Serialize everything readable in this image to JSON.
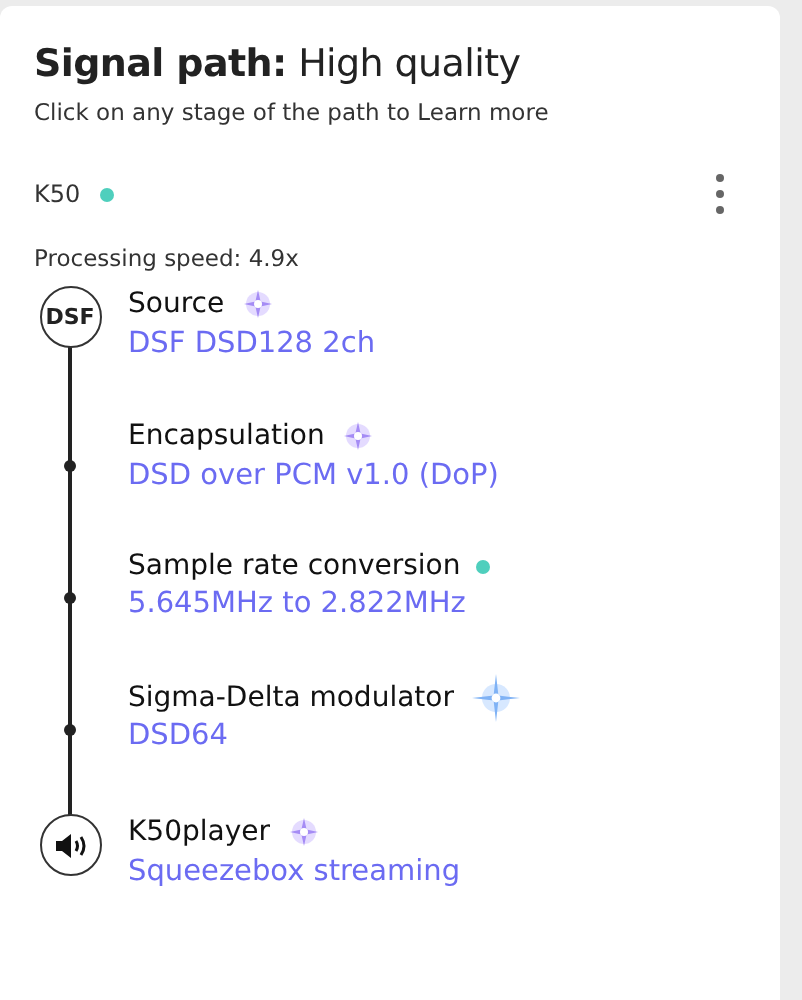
{
  "header": {
    "title": "Signal path:",
    "quality": "High quality",
    "subtitle": "Click on any stage of the path to Learn more"
  },
  "device": {
    "name": "K50",
    "color": "#4fcfbd"
  },
  "processing_speed": "Processing speed: 4.9x",
  "stages": [
    {
      "node": {
        "kind": "source",
        "label": "DSF"
      },
      "title": "Source",
      "value": "DSF DSD128 2ch",
      "indicator": {
        "kind": "sparkle"
      }
    },
    {
      "node": {
        "kind": "step"
      },
      "title": "Encapsulation",
      "value": "DSD over PCM v1.0 (DoP)",
      "indicator": {
        "kind": "sparkle"
      }
    },
    {
      "node": {
        "kind": "step"
      },
      "title": "Sample rate conversion",
      "value": "5.645MHz to 2.822MHz",
      "indicator": {
        "kind": "dot"
      }
    },
    {
      "node": {
        "kind": "step"
      },
      "title": "Sigma-Delta modulator",
      "value": "DSD64",
      "indicator": {
        "kind": "star"
      }
    },
    {
      "node": {
        "kind": "output"
      },
      "title": "K50player",
      "value": "Squeezebox streaming",
      "indicator": {
        "kind": "sparkle"
      }
    }
  ]
}
